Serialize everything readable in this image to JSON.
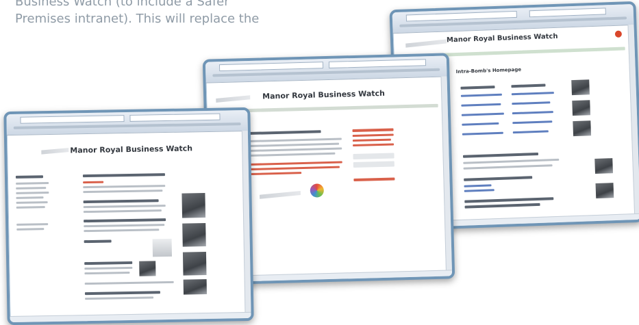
{
  "intro": {
    "line1": "Business Watch (to include a Safer",
    "line2": "Premises intranet). This will replace the"
  },
  "windows": {
    "left": {
      "title": "Manor Royal Business Watch"
    },
    "center": {
      "title": "Manor Royal Business Watch"
    },
    "right": {
      "title": "Manor Royal Business Watch",
      "heading": "Intra-Bomb's Homepage"
    }
  }
}
